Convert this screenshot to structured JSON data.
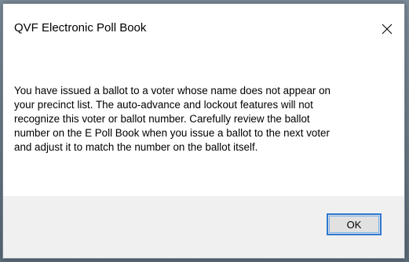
{
  "dialog": {
    "title": "QVF Electronic Poll Book",
    "close_icon": "close-icon",
    "message": "You have issued a ballot to a voter whose name does not appear on\nyour precinct list.  The auto-advance and lockout features will not\nrecognize this voter or ballot number.  Carefully review the ballot\nnumber on the E Poll Book when you issue a ballot to the next voter\nand adjust it to match the number on the ballot itself.",
    "ok_label": "OK"
  },
  "colors": {
    "dialog_bg": "#ffffff",
    "footer_bg": "#f0f0f0",
    "button_focus_border": "#2f78d0",
    "button_bg": "#e1e1e1"
  }
}
